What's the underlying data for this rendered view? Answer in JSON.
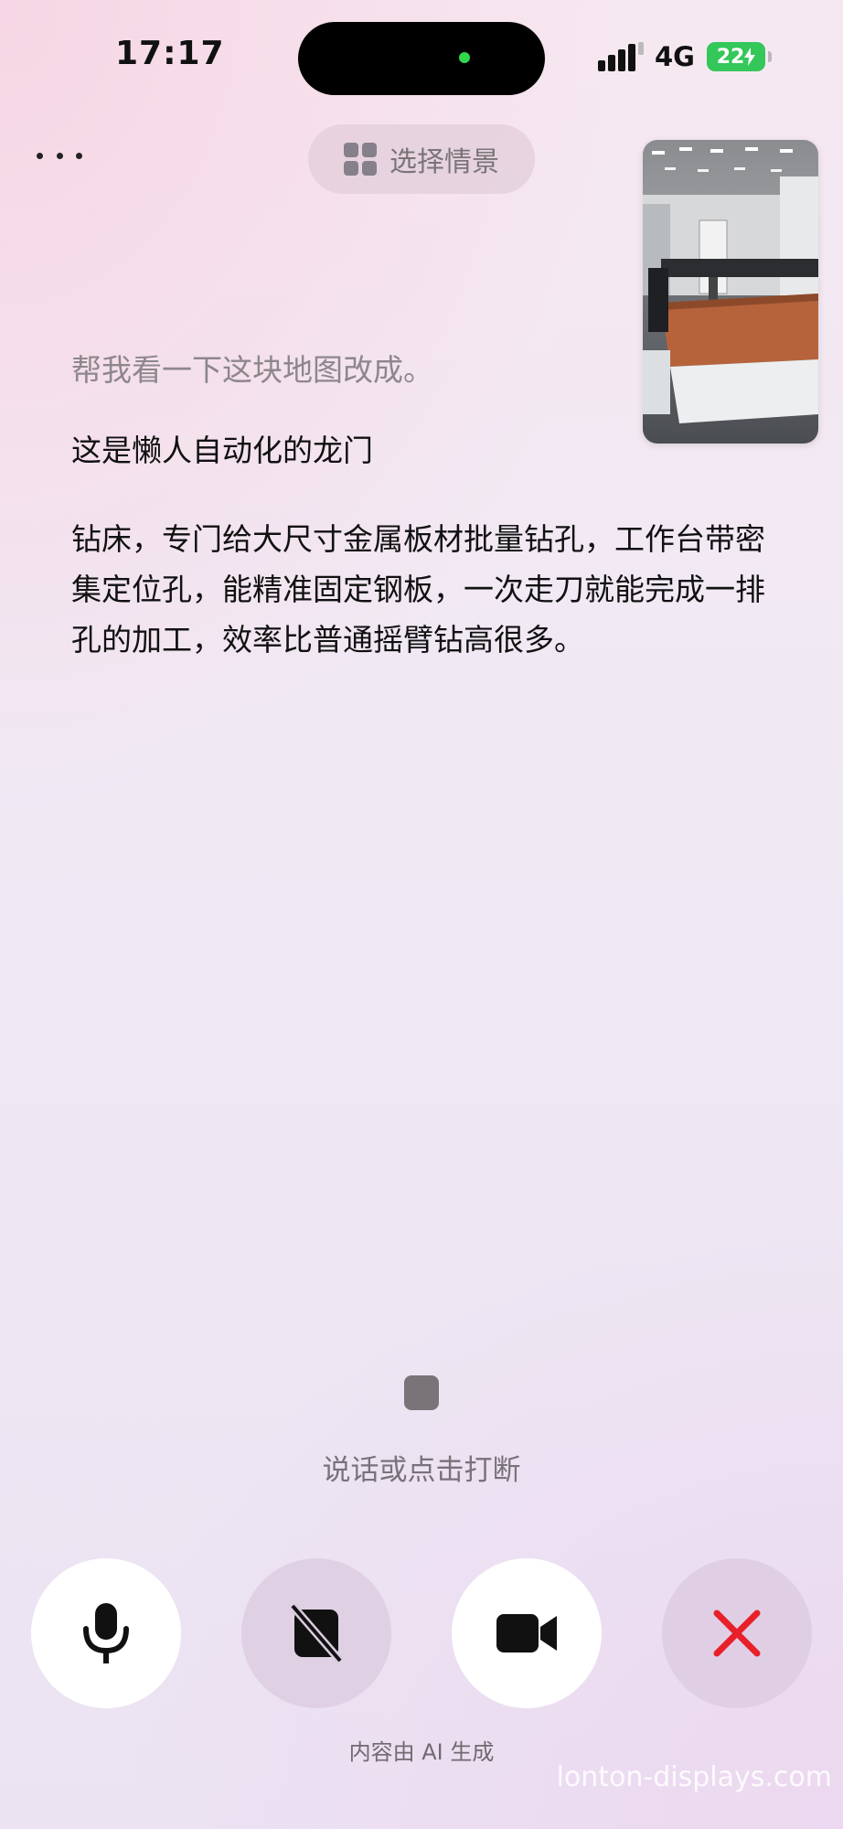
{
  "status_bar": {
    "time": "17:17",
    "network": "4G",
    "battery": "22"
  },
  "top": {
    "more_icon": "more-dots-icon",
    "scene_button_label": "选择情景",
    "scene_icon": "grid-icon"
  },
  "conversation": {
    "user_message": "帮我看一下这块地图改成。",
    "ai_message_line1": "这是懒人自动化的龙门",
    "ai_message_para": "钻床，专门给大尺寸金属板材批量钻孔，工作台带密集定位孔，能精准固定钢板，一次走刀就能完成一排孔的加工，效率比普通摇臂钻高很多。"
  },
  "interrupt": {
    "hint": "说话或点击打断",
    "stop_icon": "stop-square-icon"
  },
  "controls": [
    {
      "name": "microphone-button",
      "icon": "microphone-icon"
    },
    {
      "name": "screen-share-off-button",
      "icon": "screen-off-icon"
    },
    {
      "name": "camera-button",
      "icon": "video-camera-icon"
    },
    {
      "name": "close-button",
      "icon": "close-icon",
      "color": "#e8202a"
    }
  ],
  "footer": {
    "disclaimer": "内容由 AI 生成",
    "watermark": "lonton-displays.com"
  }
}
